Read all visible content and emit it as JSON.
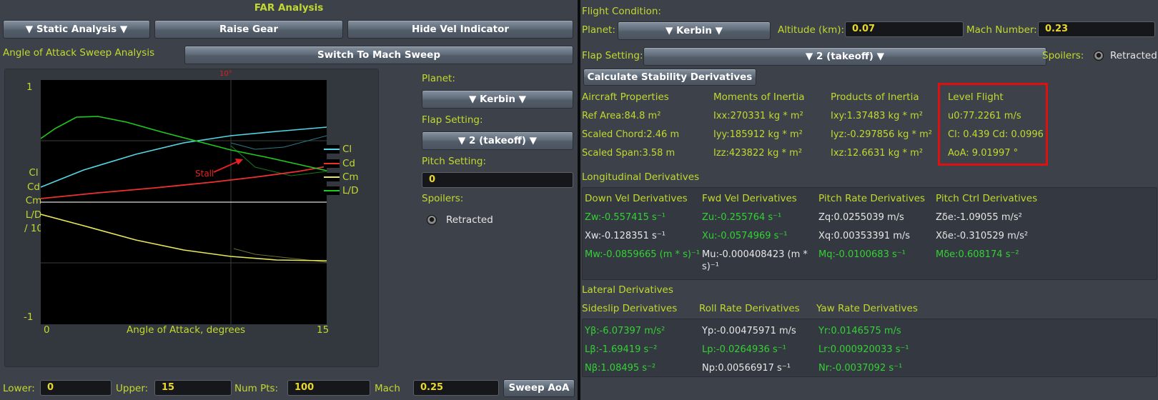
{
  "left": {
    "title": "FAR Analysis",
    "buttons": {
      "mode": "▼ Static Analysis ▼",
      "gear": "Raise Gear",
      "vel": "Hide Vel Indicator",
      "sweep_toggle": "Switch To Mach Sweep",
      "sweep_aoa": "Sweep AoA"
    },
    "section_label": "Angle of Attack Sweep Analysis",
    "graph": {
      "y_top": "1",
      "y_bottom": "-1",
      "y_label_lines": [
        "Cl",
        "Cd",
        "Cm",
        "L/D",
        "/ 10"
      ],
      "x_min": "0",
      "x_max": "15",
      "x_label": "Angle of Attack, degrees",
      "marker": "10°",
      "stall_label": "Stall",
      "legend": [
        "Cl",
        "Cd",
        "Cm",
        "L/D"
      ],
      "colors": {
        "Cl": "#53d8e8",
        "Cd": "#ee3030",
        "Cm": "#e8e858",
        "LD": "#1ecb1e",
        "bg": "#000000"
      }
    },
    "side": {
      "planet_label": "Planet:",
      "planet_value": "▼ Kerbin ▼",
      "flap_label": "Flap Setting:",
      "flap_value": "▼ 2 (takeoff) ▼",
      "pitch_label": "Pitch Setting:",
      "pitch_value": "0",
      "spoilers_label": "Spoilers:",
      "spoilers_value": "Retracted"
    },
    "bottom": {
      "lower_label": "Lower:",
      "lower_value": "0",
      "upper_label": "Upper:",
      "upper_value": "15",
      "numpts_label": "Num Pts:",
      "numpts_value": "100",
      "mach_label": "Mach",
      "mach_value": "0.25"
    }
  },
  "right": {
    "flight_condition": "Flight Condition:",
    "planet_label": "Planet:",
    "planet_value": "▼ Kerbin ▼",
    "altitude_label": "Altitude (km):",
    "altitude_value": "0.07",
    "mach_label": "Mach Number:",
    "mach_value": "0.23",
    "flap_label": "Flap Setting:",
    "flap_value": "▼ 2 (takeoff) ▼",
    "spoilers_label": "Spoilers:",
    "spoilers_value": "Retracted",
    "calc_button": "Calculate Stability Derivatives",
    "props": {
      "headers": [
        "Aircraft Properties",
        "Moments of Inertia",
        "Products of Inertia",
        "Level Flight"
      ],
      "aircraft": [
        "Ref Area:84.8 m²",
        "Scaled Chord:2.46 m",
        "Scaled Span:3.58 m"
      ],
      "moments": [
        "Ixx:270331 kg * m²",
        "Iyy:185912 kg * m²",
        "Izz:423822 kg * m²"
      ],
      "products": [
        "Ixy:1.37483 kg * m²",
        "Iyz:-0.297856 kg * m²",
        "Ixz:12.6631 kg * m²"
      ],
      "level": [
        "u0:77.2261 m/s",
        "Cl: 0.439 Cd: 0.0996",
        "AoA: 9.01997 °"
      ]
    },
    "longitudinal": {
      "title": "Longitudinal Derivatives",
      "headers": [
        "Down Vel Derivatives",
        "Fwd Vel Derivatives",
        "Pitch Rate Derivatives",
        "Pitch Ctrl Derivatives"
      ],
      "down": [
        "Zw:-0.557415 s⁻¹",
        "Xw:-0.128351 s⁻¹",
        "Mw:-0.0859665 (m * s)⁻¹"
      ],
      "fwd": [
        "Zu:-0.255764 s⁻¹",
        "Xu:-0.0574969 s⁻¹",
        "Mu:-0.000408423 (m * s)⁻¹"
      ],
      "pitch_rate": [
        "Zq:0.0255039 m/s",
        "Xq:0.00353391 m/s",
        "Mq:-0.0100683 s⁻¹"
      ],
      "pitch_ctrl": [
        "Zδe:-1.09055 m/s²",
        "Xδe:-0.310529 m/s²",
        "Mδe:0.608174 s⁻²"
      ]
    },
    "lateral": {
      "title": "Lateral Derivatives",
      "headers": [
        "Sideslip Derivatives",
        "Roll Rate Derivatives",
        "Yaw Rate Derivatives"
      ],
      "sideslip": [
        "Yβ:-6.07397 m/s²",
        "Lβ:-1.69419 s⁻²",
        "Nβ:1.08495 s⁻²"
      ],
      "roll": [
        "Yp:-0.00475971 m/s",
        "Lp:-0.0264936 s⁻¹",
        "Np:0.00566917 s⁻¹"
      ],
      "yaw": [
        "Yr:0.0146575 m/s",
        "Lr:0.000920033 s⁻¹",
        "Nr:-0.0037092 s⁻¹"
      ]
    },
    "highlight_color": "#e01010"
  }
}
